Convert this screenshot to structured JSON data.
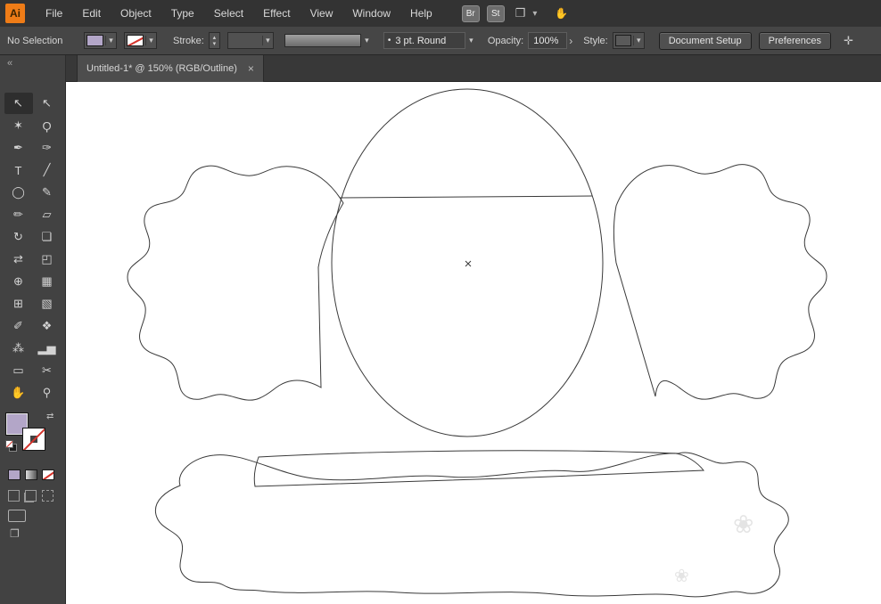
{
  "glyphs": {
    "chevron_down": "▾",
    "chevron_right": "›",
    "spinner_up": "▴",
    "spinner_down": "▾",
    "close": "×",
    "collapse": "«",
    "bullet": "•",
    "swap": "⇄",
    "workspace": "❒",
    "touch_hand": "✋",
    "wand_cursor": "✛",
    "watermark": "❀",
    "overlap_windows": "❐"
  },
  "menubar": {
    "logo": "Ai",
    "items": [
      "File",
      "Edit",
      "Object",
      "Type",
      "Select",
      "Effect",
      "View",
      "Window",
      "Help"
    ],
    "bridge_label": "Br",
    "stock_label": "St"
  },
  "controlbar": {
    "selection_status": "No Selection",
    "stroke_label": "Stroke:",
    "brush_value": "3 pt. Round",
    "opacity_label": "Opacity:",
    "opacity_value": "100%",
    "style_label": "Style:",
    "document_setup_label": "Document Setup",
    "preferences_label": "Preferences"
  },
  "toolbar": {
    "tools": [
      {
        "name": "selection-tool",
        "glyph": "↖"
      },
      {
        "name": "direct-selection-tool",
        "glyph": "↖"
      },
      {
        "name": "magic-wand-tool",
        "glyph": "✶"
      },
      {
        "name": "lasso-tool",
        "glyph": "Ϙ"
      },
      {
        "name": "pen-tool",
        "glyph": "✒"
      },
      {
        "name": "curvature-tool",
        "glyph": "✑"
      },
      {
        "name": "type-tool",
        "glyph": "T"
      },
      {
        "name": "line-segment-tool",
        "glyph": "╱"
      },
      {
        "name": "ellipse-tool",
        "glyph": "◯"
      },
      {
        "name": "paintbrush-tool",
        "glyph": "✎"
      },
      {
        "name": "pencil-tool",
        "glyph": "✏"
      },
      {
        "name": "eraser-tool",
        "glyph": "▱"
      },
      {
        "name": "rotate-tool",
        "glyph": "↻"
      },
      {
        "name": "scale-tool",
        "glyph": "❏"
      },
      {
        "name": "width-tool",
        "glyph": "⇄"
      },
      {
        "name": "free-transform-tool",
        "glyph": "◰"
      },
      {
        "name": "shape-builder-tool",
        "glyph": "⊕"
      },
      {
        "name": "perspective-grid-tool",
        "glyph": "▦"
      },
      {
        "name": "mesh-tool",
        "glyph": "⊞"
      },
      {
        "name": "gradient-tool",
        "glyph": "▧"
      },
      {
        "name": "eyedropper-tool",
        "glyph": "✐"
      },
      {
        "name": "blend-tool",
        "glyph": "❖"
      },
      {
        "name": "symbol-sprayer-tool",
        "glyph": "⁂"
      },
      {
        "name": "column-graph-tool",
        "glyph": "▂▅"
      },
      {
        "name": "artboard-tool",
        "glyph": "▭"
      },
      {
        "name": "slice-tool",
        "glyph": "✂"
      },
      {
        "name": "hand-tool",
        "glyph": "✋"
      },
      {
        "name": "zoom-tool",
        "glyph": "⚲"
      }
    ]
  },
  "tabbar": {
    "tab_title": "Untitled-1* @ 150% (RGB/Outline)"
  },
  "artwork": {
    "shapes": [
      "ellipse",
      "chord-line",
      "left-cloud",
      "right-cloud",
      "base-slab",
      "base-puddle",
      "center-mark"
    ],
    "stroke_color": "#3a3a3a"
  },
  "colors": {
    "fill_purple": "#b3a6c8",
    "slash_red": "#d5342c",
    "logo_orange": "#ef7c17"
  }
}
